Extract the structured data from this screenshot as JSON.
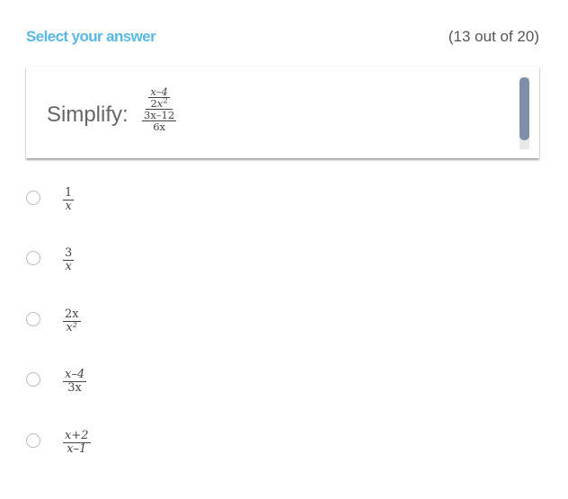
{
  "header": {
    "title": "Select your answer",
    "progress": "(13 out of 20)"
  },
  "colors": {
    "accent": "#5bb8e6",
    "scrollbar_thumb": "#7f8fa9"
  },
  "question": {
    "prompt": "Simplify:",
    "expression": {
      "numerator": {
        "numerator": "x–4",
        "denominator_coef": "2",
        "denominator_var": "x",
        "denominator_exp": "2"
      },
      "denominator": {
        "numerator": "3x–12",
        "denominator": "6x"
      }
    }
  },
  "options": [
    {
      "label": "1/x",
      "numerator": "1",
      "denominator": "x",
      "selected": false
    },
    {
      "label": "3/x",
      "numerator": "3",
      "denominator": "x",
      "selected": false
    },
    {
      "label": "2x/x^2",
      "numerator": "2x",
      "denominator": "x²",
      "selected": false
    },
    {
      "label": "(x-4)/(3x)",
      "numerator": "x–4",
      "denominator": "3x",
      "selected": false
    },
    {
      "label": "(x+2)/(x-1)",
      "numerator": "x+2",
      "denominator": "x–1",
      "selected": false
    }
  ]
}
